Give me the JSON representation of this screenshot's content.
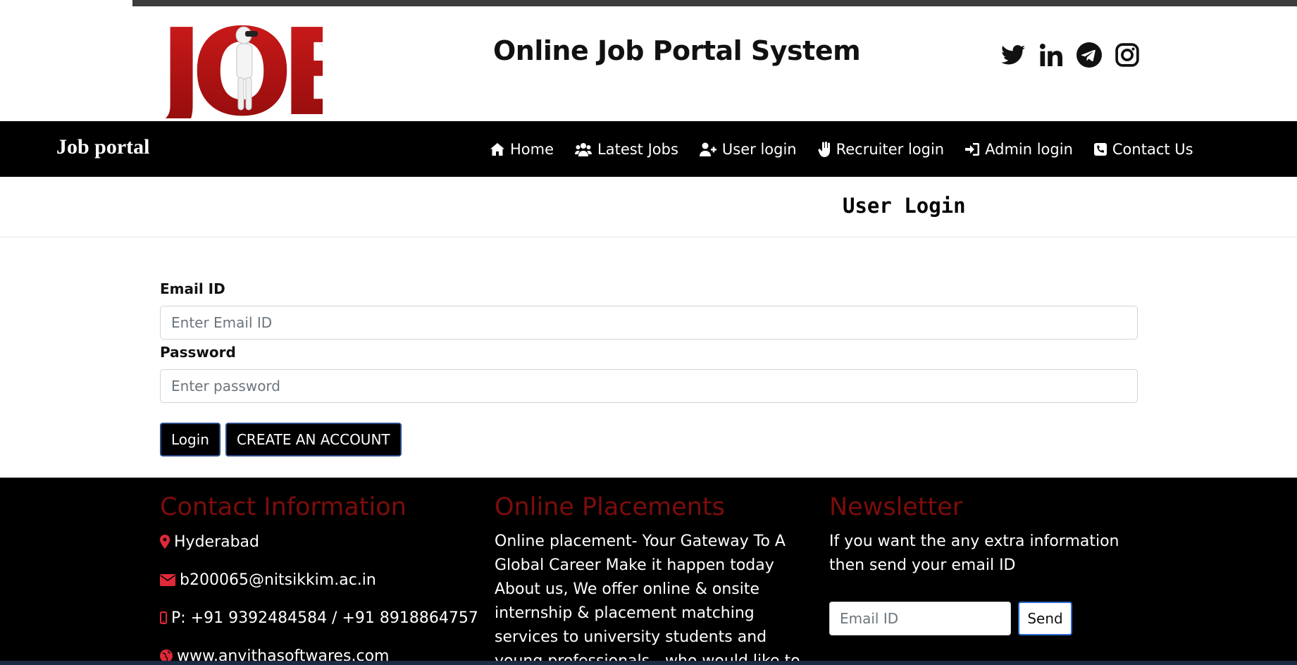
{
  "header": {
    "logo_text": "JOB",
    "title": "Online Job Portal System",
    "social": [
      "twitter-icon",
      "linkedin-icon",
      "telegram-icon",
      "instagram-icon"
    ]
  },
  "navbar": {
    "brand": "Job portal",
    "items": [
      {
        "label": "Home",
        "icon": "home-icon"
      },
      {
        "label": "Latest Jobs",
        "icon": "users-icon"
      },
      {
        "label": "User login",
        "icon": "user-plus-icon"
      },
      {
        "label": "Recruiter login",
        "icon": "hand-icon"
      },
      {
        "label": "Admin login",
        "icon": "sign-in-icon"
      },
      {
        "label": "Contact Us",
        "icon": "phone-square-icon"
      }
    ]
  },
  "page": {
    "heading": "User Login"
  },
  "form": {
    "email_label": "Email ID",
    "email_placeholder": "Enter Email ID",
    "email_value": "",
    "password_label": "Password",
    "password_placeholder": "Enter password",
    "password_value": "",
    "login_button": "Login",
    "create_button": "CREATE AN ACCOUNT"
  },
  "footer": {
    "contact": {
      "title": "Contact Information",
      "city": "Hyderabad",
      "email": "b200065@nitsikkim.ac.in",
      "phone": "P: +91 9392484584 / +91 8918864757",
      "website": "www.anvithasoftwares.com"
    },
    "placements": {
      "title": "Online Placements",
      "text": "Online placement- Your Gateway To A Global Career Make it happen today About us, We offer online & onsite internship & placement matching services to university students and young professionals - who would like to gain international working"
    },
    "newsletter": {
      "title": "Newsletter",
      "text": "If you want the any extra information then send your email ID",
      "placeholder": "Email ID",
      "send": "Send"
    }
  },
  "colors": {
    "navbar_bg": "#000000",
    "footer_heading": "#7d0c0c",
    "logo_red": "#b01212",
    "icon_red": "#e0293a"
  }
}
